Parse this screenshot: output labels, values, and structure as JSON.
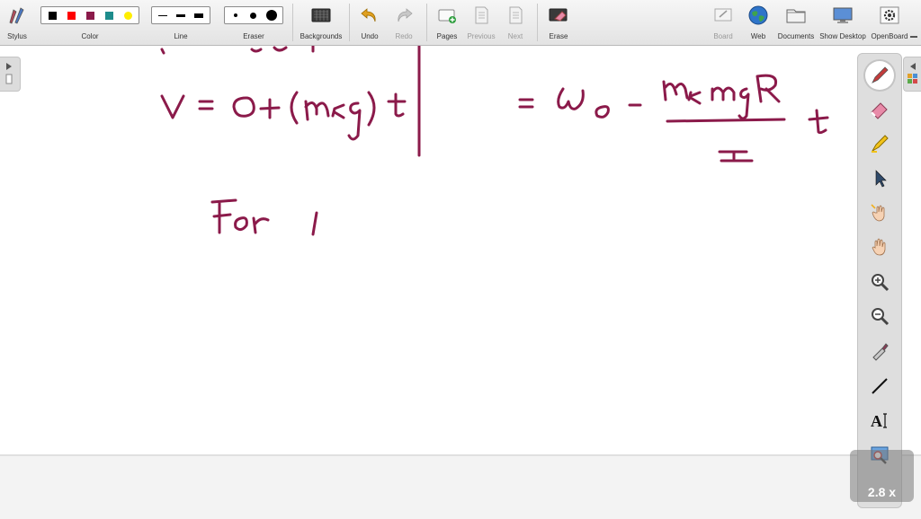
{
  "toolbar": {
    "stylus": "Stylus",
    "color": "Color",
    "line": "Line",
    "eraser": "Eraser",
    "backgrounds": "Backgrounds",
    "undo": "Undo",
    "redo": "Redo",
    "pages": "Pages",
    "previous": "Previous",
    "next": "Next",
    "erase": "Erase",
    "board": "Board",
    "web": "Web",
    "documents": "Documents",
    "show_desktop": "Show Desktop",
    "openboard": "OpenBoard",
    "colors": [
      "#000000",
      "#ff0000",
      "#8b1a4a",
      "#1e8c8c",
      "#ffee00"
    ]
  },
  "zoom": {
    "level": "2.8 x"
  },
  "right_tools": [
    "pen-icon",
    "eraser-icon",
    "highlighter-icon",
    "pointer-icon",
    "laser-hand-icon",
    "hand-icon",
    "zoom-in-icon",
    "zoom-out-icon",
    "color-picker-icon",
    "line-icon",
    "text-icon",
    "capture-icon"
  ],
  "ink_color": "#8b1a4a"
}
